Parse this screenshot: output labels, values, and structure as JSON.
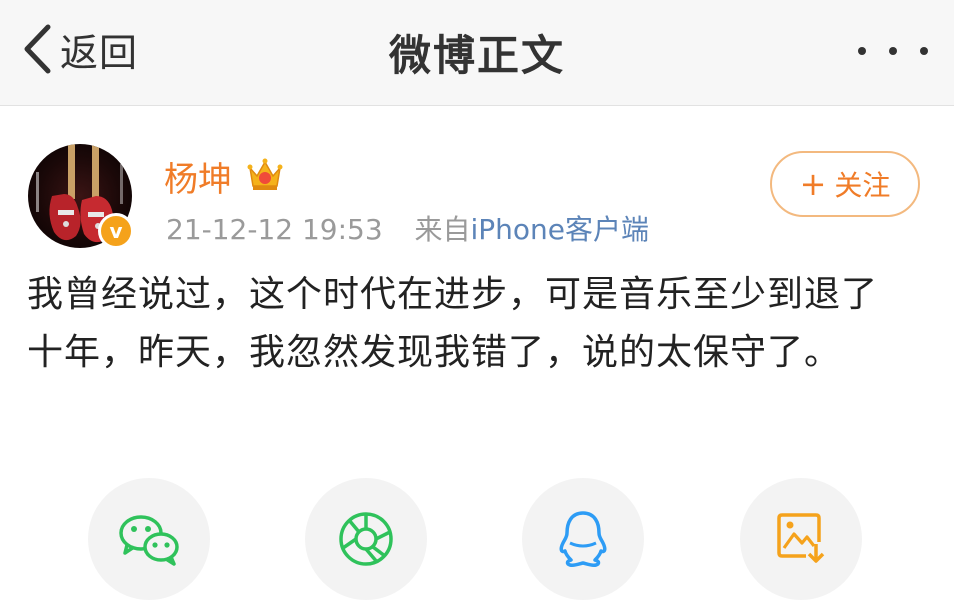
{
  "navbar": {
    "back_label": "返回",
    "title": "微博正文",
    "more_icon": "more-icon"
  },
  "post": {
    "author": "杨坤",
    "vip_icon": "crown-icon",
    "verified_mark": "v",
    "timestamp": "21-12-12 19:53",
    "source_prefix": "来自",
    "source": "iPhone客户端",
    "follow_label": "关注",
    "content": "我曾经说过，这个时代在进步，可是音乐至少到退了十年，昨天，我忽然发现我错了，说的太保守了。"
  },
  "share": [
    {
      "icon": "wechat-icon",
      "color": "#2fc25b"
    },
    {
      "icon": "moments-icon",
      "color": "#2fc25b"
    },
    {
      "icon": "qq-icon",
      "color": "#2d9cf5"
    },
    {
      "icon": "save-image-icon",
      "color": "#f5a21b"
    }
  ],
  "colors": {
    "accent": "#f07c28",
    "link": "#5c84b8",
    "follow_border": "#f3b97f"
  }
}
